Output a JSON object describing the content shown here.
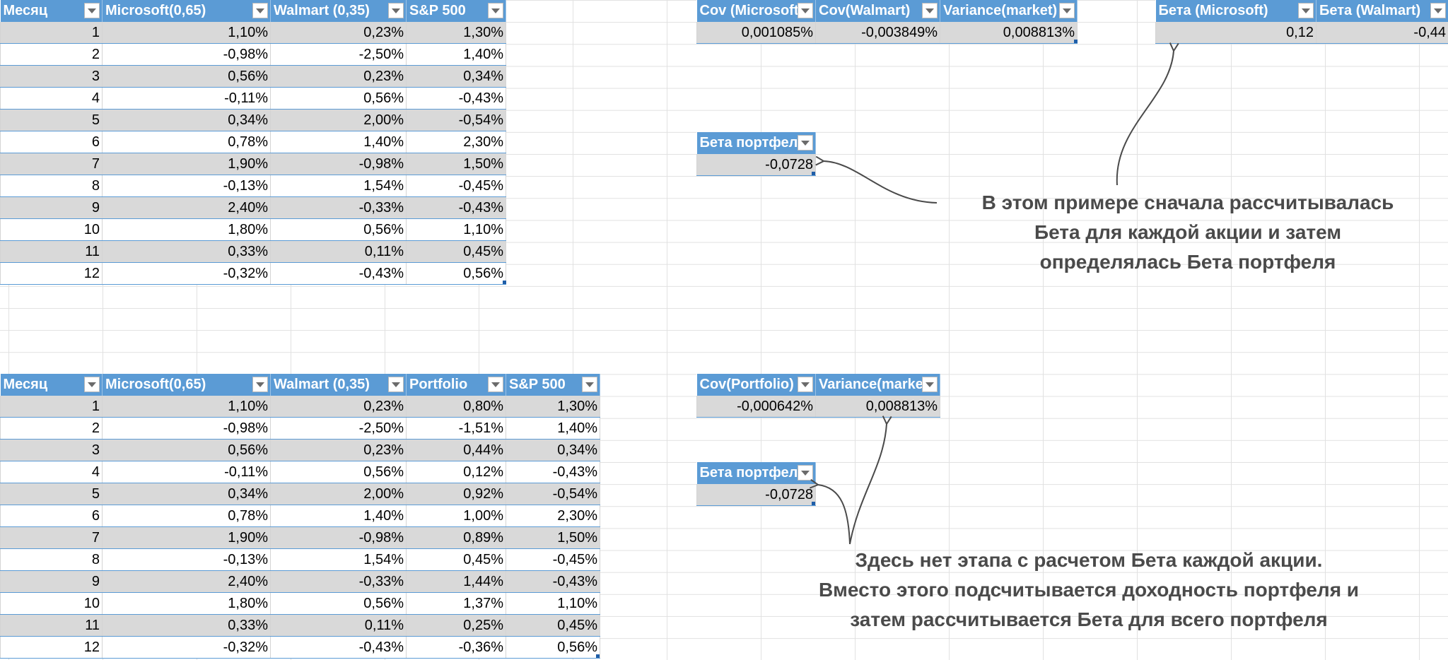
{
  "table_top": {
    "headers": [
      "Месяц",
      "Microsoft(0,65)",
      "Walmart (0,35)",
      "S&P 500"
    ],
    "rows": [
      [
        "1",
        "1,10%",
        "0,23%",
        "1,30%"
      ],
      [
        "2",
        "-0,98%",
        "-2,50%",
        "1,40%"
      ],
      [
        "3",
        "0,56%",
        "0,23%",
        "0,34%"
      ],
      [
        "4",
        "-0,11%",
        "0,56%",
        "-0,43%"
      ],
      [
        "5",
        "0,34%",
        "2,00%",
        "-0,54%"
      ],
      [
        "6",
        "0,78%",
        "1,40%",
        "2,30%"
      ],
      [
        "7",
        "1,90%",
        "-0,98%",
        "1,50%"
      ],
      [
        "8",
        "-0,13%",
        "1,54%",
        "-0,45%"
      ],
      [
        "9",
        "2,40%",
        "-0,33%",
        "-0,43%"
      ],
      [
        "10",
        "1,80%",
        "0,56%",
        "1,10%"
      ],
      [
        "11",
        "0,33%",
        "0,11%",
        "0,45%"
      ],
      [
        "12",
        "-0,32%",
        "-0,43%",
        "0,56%"
      ]
    ]
  },
  "table_cov": {
    "headers": [
      "Cov (Microsoft)",
      "Cov(Walmart)",
      "Variance(market)"
    ],
    "values": [
      "0,001085%",
      "-0,003849%",
      "0,008813%"
    ]
  },
  "table_beta_stocks": {
    "headers": [
      "Бета (Microsoft)",
      "Бета (Walmart)"
    ],
    "values": [
      "0,12",
      "-0,44"
    ]
  },
  "table_beta_portfolio_1": {
    "header": "Бета портфеля",
    "value": "-0,0728"
  },
  "note_1": {
    "line1": "В этом примере сначала рассчитывалась",
    "line2": "Бета для каждой акции и затем",
    "line3": "определялась Бета портфеля"
  },
  "table_bottom": {
    "headers": [
      "Месяц",
      "Microsoft(0,65)",
      "Walmart (0,35)",
      "Portfolio",
      "S&P 500"
    ],
    "rows": [
      [
        "1",
        "1,10%",
        "0,23%",
        "0,80%",
        "1,30%"
      ],
      [
        "2",
        "-0,98%",
        "-2,50%",
        "-1,51%",
        "1,40%"
      ],
      [
        "3",
        "0,56%",
        "0,23%",
        "0,44%",
        "0,34%"
      ],
      [
        "4",
        "-0,11%",
        "0,56%",
        "0,12%",
        "-0,43%"
      ],
      [
        "5",
        "0,34%",
        "2,00%",
        "0,92%",
        "-0,54%"
      ],
      [
        "6",
        "0,78%",
        "1,40%",
        "1,00%",
        "2,30%"
      ],
      [
        "7",
        "1,90%",
        "-0,98%",
        "0,89%",
        "1,50%"
      ],
      [
        "8",
        "-0,13%",
        "1,54%",
        "0,45%",
        "-0,45%"
      ],
      [
        "9",
        "2,40%",
        "-0,33%",
        "1,44%",
        "-0,43%"
      ],
      [
        "10",
        "1,80%",
        "0,56%",
        "1,37%",
        "1,10%"
      ],
      [
        "11",
        "0,33%",
        "0,11%",
        "0,25%",
        "0,45%"
      ],
      [
        "12",
        "-0,32%",
        "-0,43%",
        "-0,36%",
        "0,56%"
      ]
    ]
  },
  "table_cov_portfolio": {
    "headers": [
      "Cov(Portfolio)",
      "Variance(market)"
    ],
    "values": [
      "-0,000642%",
      "0,008813%"
    ]
  },
  "table_beta_portfolio_2": {
    "header": "Бета портфеля",
    "value": "-0,0728"
  },
  "note_2": {
    "line1": "Здесь нет этапа с расчетом Бета каждой акции.",
    "line2": "Вместо этого подсчитывается доходность портфеля и",
    "line3": "затем рассчитывается Бета для всего портфеля"
  },
  "colors": {
    "header_bg": "#5b9bd5",
    "band_bg": "#d9d9d9",
    "note_text": "#4a4a4a"
  }
}
